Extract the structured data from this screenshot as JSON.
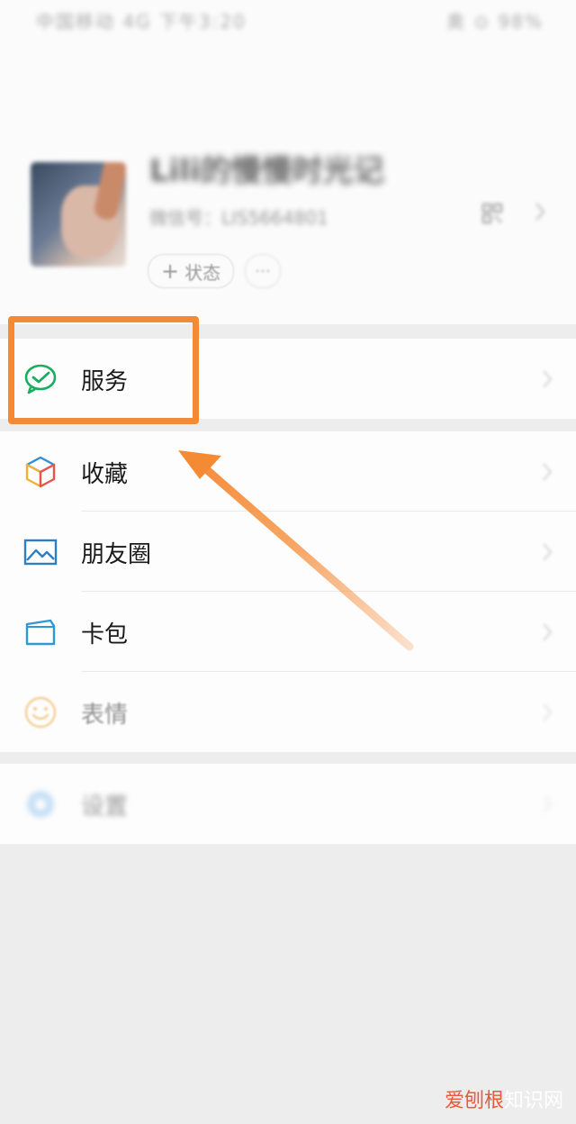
{
  "status_bar": {
    "left_text": "中国移动 4G 下午3:20",
    "right_text": "奥 ⊙ 98%"
  },
  "profile": {
    "nickname": "Lili的慢慢时光记",
    "wechat_id": "微信号：LIS5664801",
    "status_label": "状态",
    "more_label": "···"
  },
  "menu": {
    "services": {
      "label": "服务",
      "icon": "wechat-pay-icon"
    },
    "items": [
      {
        "label": "收藏",
        "icon": "cube-icon"
      },
      {
        "label": "朋友圈",
        "icon": "image-icon"
      },
      {
        "label": "卡包",
        "icon": "card-wallet-icon"
      },
      {
        "label": "表情",
        "icon": "smiley-icon"
      }
    ],
    "settings": {
      "label": "设置",
      "icon": "gear-icon"
    }
  },
  "annotation": {
    "highlight_color": "#f58a35"
  },
  "watermark": {
    "part1": "爱刨根",
    "part2": "知识网"
  }
}
